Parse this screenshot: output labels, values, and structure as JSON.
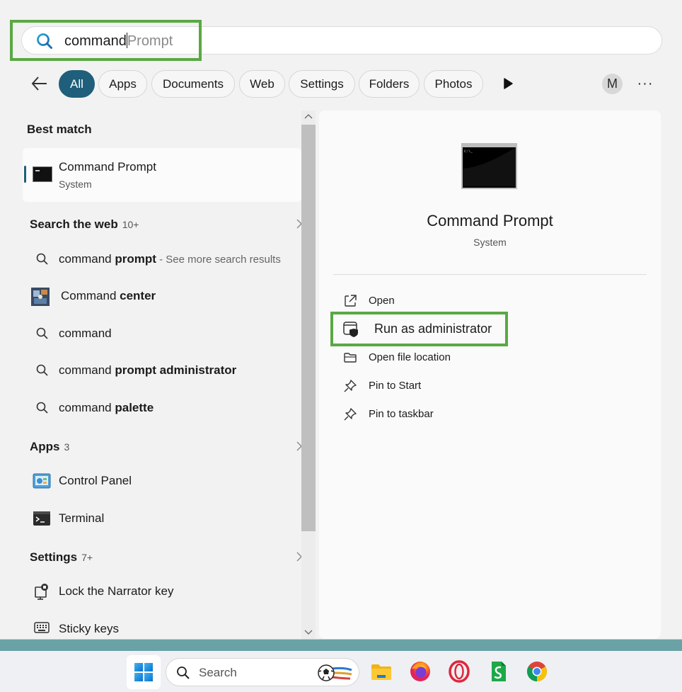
{
  "search": {
    "typed": "command",
    "suggestion": "Prompt"
  },
  "filters": [
    {
      "label": "All",
      "active": true
    },
    {
      "label": "Apps"
    },
    {
      "label": "Documents"
    },
    {
      "label": "Web"
    },
    {
      "label": "Settings"
    },
    {
      "label": "Folders"
    },
    {
      "label": "Photos"
    }
  ],
  "account_initial": "M",
  "more_menu": "···",
  "best_match": {
    "heading": "Best match",
    "title": "Command Prompt",
    "subtitle": "System"
  },
  "web": {
    "heading": "Search the web",
    "count": "10+",
    "items": [
      {
        "plain": "command ",
        "bold": "prompt",
        "extra": " - See more search results",
        "icon": "search-icon"
      },
      {
        "plain": "Command ",
        "bold": "center",
        "extra": "",
        "icon": "thumbnail-image-icon"
      },
      {
        "plain": "command",
        "bold": "",
        "extra": "",
        "icon": "search-icon"
      },
      {
        "plain": "command ",
        "bold": "prompt administrator",
        "extra": "",
        "icon": "search-icon"
      },
      {
        "plain": "command ",
        "bold": "palette",
        "extra": "",
        "icon": "search-icon"
      }
    ]
  },
  "apps": {
    "heading": "Apps",
    "count": "3",
    "items": [
      {
        "label": "Control Panel",
        "icon": "control-panel-icon"
      },
      {
        "label": "Terminal",
        "icon": "terminal-icon"
      }
    ]
  },
  "settings": {
    "heading": "Settings",
    "count": "7+",
    "items": [
      {
        "label": "Lock the Narrator key",
        "icon": "narrator-icon"
      },
      {
        "label": "Sticky keys",
        "icon": "keyboard-icon"
      }
    ]
  },
  "detail": {
    "title": "Command Prompt",
    "subtitle": "System",
    "actions": [
      {
        "label": "Open",
        "icon": "open-external-icon"
      },
      {
        "label": "Run as administrator",
        "icon": "shield-window-icon"
      },
      {
        "label": "Open file location",
        "icon": "folder-icon"
      },
      {
        "label": "Pin to Start",
        "icon": "pin-icon"
      },
      {
        "label": "Pin to taskbar",
        "icon": "pin-icon"
      }
    ]
  },
  "taskbar": {
    "search_label": "Search",
    "apps": [
      "file-explorer-icon",
      "firefox-icon",
      "opera-icon",
      "sheets-app-icon",
      "chrome-icon"
    ]
  },
  "colors": {
    "accent": "#1f5f7b",
    "highlight_box": "#5aa844"
  }
}
